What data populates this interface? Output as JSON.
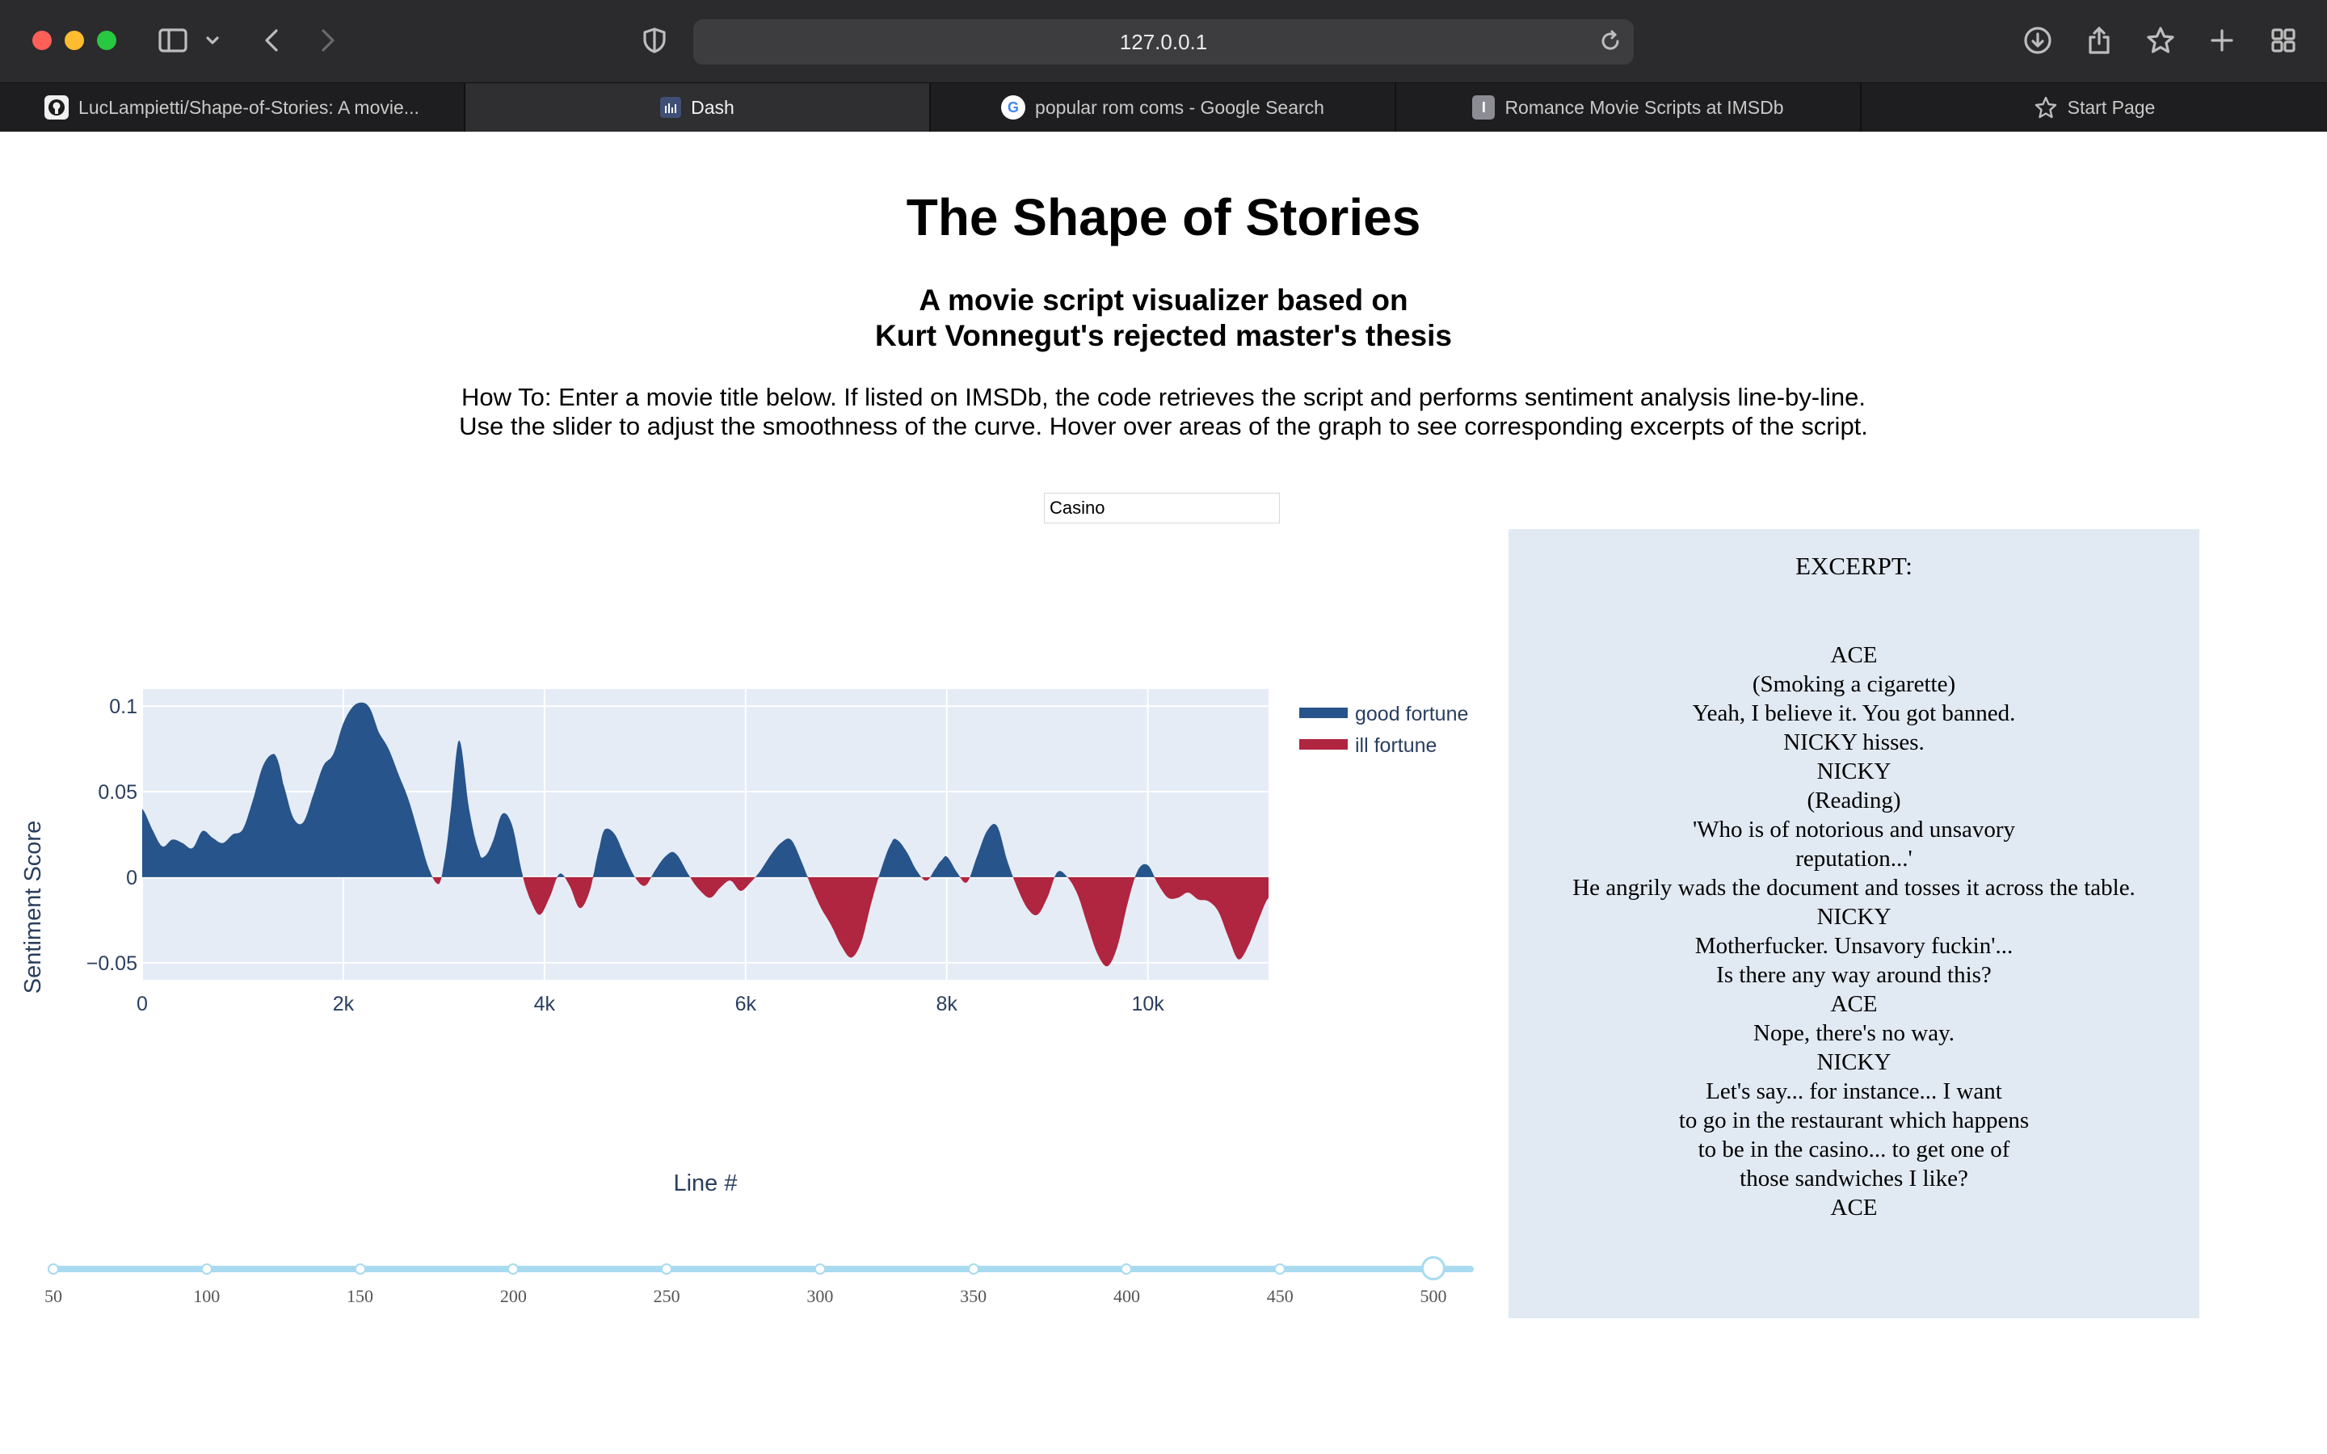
{
  "browser": {
    "url": "127.0.0.1",
    "tabs": [
      {
        "label": "LucLampietti/Shape-of-Stories: A movie...",
        "icon": "github-icon",
        "active": false
      },
      {
        "label": "Dash",
        "icon": "dash-icon",
        "active": true
      },
      {
        "label": "popular rom coms - Google Search",
        "icon": "google-icon",
        "active": false
      },
      {
        "label": "Romance Movie Scripts at IMSDb",
        "icon": "imsdb-icon",
        "active": false
      },
      {
        "label": "Start Page",
        "icon": "star-icon",
        "active": false
      }
    ]
  },
  "page": {
    "title": "The Shape of Stories",
    "subtitle_line1": "A movie script visualizer based on",
    "subtitle_line2": "Kurt Vonnegut's rejected master's thesis",
    "howto_line1": "How To: Enter a movie title below. If listed on IMSDb, the code retrieves the script and performs sentiment analysis line-by-line.",
    "howto_line2": "Use the slider to adjust the smoothness of the curve. Hover over areas of the graph to see corresponding excerpts of the script."
  },
  "movie_input": {
    "value": "Casino"
  },
  "chart_data": {
    "type": "area",
    "xlabel": "Line #",
    "ylabel": "Sentiment Score",
    "xlim": [
      0,
      11200
    ],
    "ylim": [
      -0.06,
      0.11
    ],
    "xticks": [
      0,
      2000,
      4000,
      6000,
      8000,
      10000
    ],
    "xtick_labels": [
      "0",
      "2k",
      "4k",
      "6k",
      "8k",
      "10k"
    ],
    "yticks": [
      -0.05,
      0,
      0.05,
      0.1
    ],
    "ytick_labels": [
      "−0.05",
      "0",
      "0.05",
      "0.1"
    ],
    "grid": true,
    "legend_position": "top-right",
    "series": [
      {
        "name": "good fortune",
        "color": "#27548a"
      },
      {
        "name": "ill fortune",
        "color": "#b02540"
      }
    ],
    "x": [
      0,
      100,
      200,
      300,
      400,
      500,
      600,
      700,
      800,
      900,
      1000,
      1100,
      1200,
      1300,
      1350,
      1400,
      1500,
      1600,
      1700,
      1800,
      1900,
      2000,
      2100,
      2200,
      2270,
      2350,
      2450,
      2550,
      2650,
      2750,
      2850,
      2950,
      3000,
      3060,
      3150,
      3250,
      3350,
      3400,
      3480,
      3580,
      3680,
      3780,
      3850,
      3950,
      4050,
      4150,
      4250,
      4350,
      4450,
      4550,
      4600,
      4700,
      4800,
      4900,
      5000,
      5100,
      5200,
      5300,
      5450,
      5550,
      5650,
      5750,
      5850,
      5950,
      6050,
      6150,
      6250,
      6350,
      6450,
      6550,
      6650,
      6750,
      6850,
      6950,
      7050,
      7150,
      7250,
      7350,
      7450,
      7500,
      7600,
      7700,
      7800,
      7900,
      7950,
      8000,
      8100,
      8200,
      8300,
      8400,
      8500,
      8600,
      8700,
      8800,
      8900,
      9000,
      9100,
      9200,
      9300,
      9400,
      9500,
      9600,
      9700,
      9800,
      9900,
      10000,
      10100,
      10200,
      10300,
      10400,
      10500,
      10600,
      10700,
      10800,
      10900,
      11000,
      11100,
      11200
    ],
    "y": [
      0.04,
      0.028,
      0.018,
      0.022,
      0.02,
      0.017,
      0.027,
      0.023,
      0.02,
      0.025,
      0.028,
      0.045,
      0.065,
      0.072,
      0.068,
      0.055,
      0.035,
      0.032,
      0.048,
      0.065,
      0.072,
      0.09,
      0.1,
      0.102,
      0.098,
      0.085,
      0.075,
      0.06,
      0.045,
      0.025,
      0.005,
      -0.004,
      0.008,
      0.035,
      0.08,
      0.04,
      0.015,
      0.012,
      0.02,
      0.037,
      0.03,
      0.002,
      -0.012,
      -0.022,
      -0.012,
      0.002,
      -0.005,
      -0.018,
      -0.008,
      0.018,
      0.028,
      0.025,
      0.012,
      0.0,
      -0.005,
      0.004,
      0.012,
      0.014,
      0.0,
      -0.008,
      -0.012,
      -0.006,
      -0.002,
      -0.008,
      -0.003,
      0.004,
      0.013,
      0.02,
      0.022,
      0.01,
      -0.005,
      -0.018,
      -0.028,
      -0.04,
      -0.047,
      -0.038,
      -0.015,
      0.005,
      0.02,
      0.022,
      0.015,
      0.004,
      -0.002,
      0.006,
      0.01,
      0.012,
      0.003,
      -0.003,
      0.012,
      0.027,
      0.03,
      0.01,
      -0.006,
      -0.018,
      -0.022,
      -0.012,
      0.003,
      0.0,
      -0.01,
      -0.028,
      -0.045,
      -0.052,
      -0.04,
      -0.015,
      0.004,
      0.007,
      -0.004,
      -0.012,
      -0.012,
      -0.009,
      -0.013,
      -0.014,
      -0.02,
      -0.035,
      -0.048,
      -0.04,
      -0.025,
      -0.012
    ]
  },
  "slider": {
    "marks": [
      "50",
      "100",
      "150",
      "200",
      "250",
      "300",
      "350",
      "400",
      "450",
      "500"
    ],
    "value": 500,
    "min": 50,
    "max": 500
  },
  "excerpt": {
    "heading": "EXCERPT:",
    "lines": [
      "ACE",
      "(Smoking a cigarette)",
      "Yeah, I believe it. You got banned.",
      "NICKY hisses.",
      "NICKY",
      "(Reading)",
      "'Who is of notorious and unsavory",
      "reputation...'",
      "He angrily wads the document and tosses it across the table.",
      "NICKY",
      "Motherfucker. Unsavory fuckin'...",
      "Is there any way around this?",
      "ACE",
      "Nope, there's no way.",
      "NICKY",
      "Let's say... for instance... I want",
      "to go in the restaurant which happens",
      "to be in the casino... to get one of",
      "those sandwiches I like?",
      "ACE"
    ]
  }
}
